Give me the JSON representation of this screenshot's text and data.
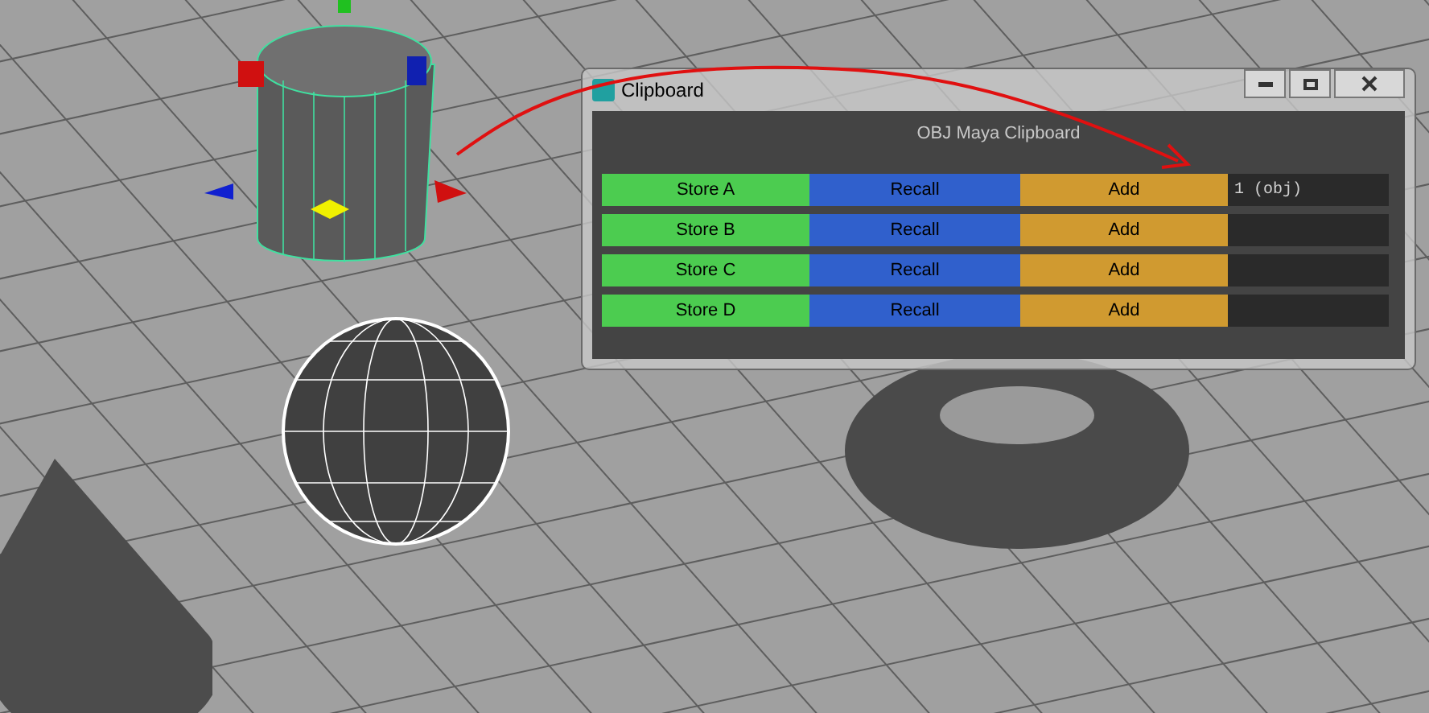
{
  "window": {
    "title": "Clipboard"
  },
  "heading": "OBJ Maya Clipboard",
  "rows": [
    {
      "store": "Store A",
      "recall": "Recall",
      "add": "Add",
      "contents": "1 (obj)"
    },
    {
      "store": "Store B",
      "recall": "Recall",
      "add": "Add"
    },
    {
      "store": "Store C",
      "recall": "Recall",
      "add": "Add"
    },
    {
      "store": "Store D",
      "recall": "Recall",
      "add": "Add"
    }
  ]
}
